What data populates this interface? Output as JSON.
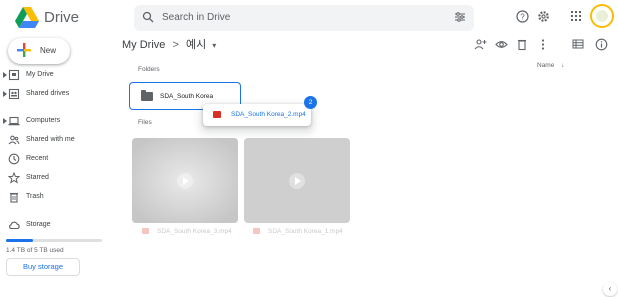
{
  "app": {
    "name": "Drive"
  },
  "search": {
    "placeholder": "Search in Drive"
  },
  "new_button": {
    "label": "New"
  },
  "sidebar": {
    "items": [
      {
        "label": "My Drive",
        "icon": "my-drive-icon",
        "expandable": true
      },
      {
        "label": "Shared drives",
        "icon": "shared-drives-icon",
        "expandable": true
      },
      {
        "label": "Computers",
        "icon": "computers-icon",
        "expandable": true
      },
      {
        "label": "Shared with me",
        "icon": "shared-with-me-icon",
        "expandable": false
      },
      {
        "label": "Recent",
        "icon": "recent-icon",
        "expandable": false
      },
      {
        "label": "Starred",
        "icon": "starred-icon",
        "expandable": false
      },
      {
        "label": "Trash",
        "icon": "trash-icon",
        "expandable": false
      },
      {
        "label": "Storage",
        "icon": "cloud-icon",
        "expandable": false
      }
    ]
  },
  "storage": {
    "used_text": "1.4 TB of 5 TB used",
    "used_fraction": 0.28,
    "buy_label": "Buy storage"
  },
  "breadcrumb": {
    "root": "My Drive",
    "separator": ">",
    "current": "예시"
  },
  "main": {
    "folders_label": "Folders",
    "files_label": "Files",
    "sort_label": "Name",
    "folders": [
      {
        "name": "SDA_South Korea"
      }
    ],
    "files": [
      {
        "name": "SDA_South Korea_3.mp4"
      },
      {
        "name": "SDA_South Korea_1.mp4"
      }
    ]
  },
  "drag": {
    "item_name": "SDA_South Korea_2.mp4",
    "count": "2"
  },
  "colors": {
    "accent": "#1a73e8",
    "video_icon": "#d93025",
    "thumb": "#cfcfcf"
  }
}
